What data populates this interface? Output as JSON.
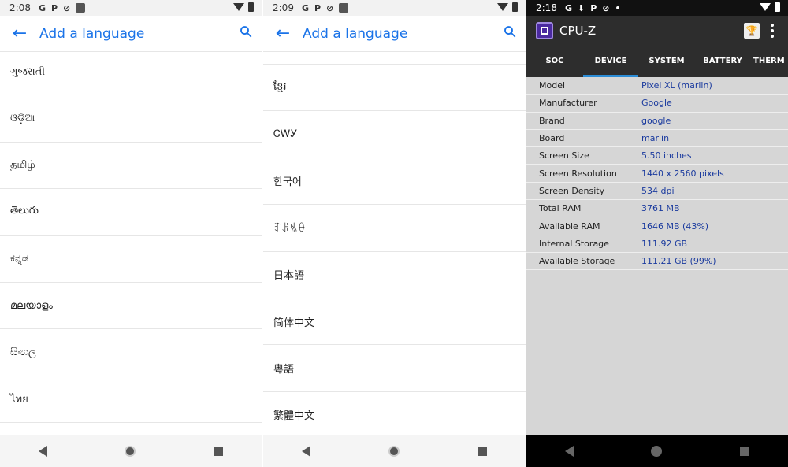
{
  "panel1": {
    "status": {
      "time": "2:08",
      "icons": [
        "G",
        "P",
        "⊘"
      ]
    },
    "appbar": {
      "title": "Add a language"
    },
    "languages": [
      "ગુજરાતી",
      "ଓଡ଼ିଆ",
      "தமிழ்",
      "తెలుగు",
      "ಕನ್ನಡ",
      "മലയാളം",
      "සිංහල",
      "ไทย"
    ]
  },
  "panel2": {
    "status": {
      "time": "2:09",
      "icons": [
        "G",
        "P",
        "⊘"
      ]
    },
    "appbar": {
      "title": "Add a language"
    },
    "languages": [
      "ខ្មែរ",
      "ᏣᎳᎩ",
      "한국어",
      "ꆈꌠꁱꂷ",
      "日本語",
      "简体中文",
      "粵語",
      "繁體中文"
    ]
  },
  "panel3": {
    "status": {
      "time": "2:18",
      "icons": [
        "G",
        "⬇",
        "P",
        "⊘",
        "•"
      ]
    },
    "app_title": "CPU-Z",
    "tabs": [
      "SOC",
      "DEVICE",
      "SYSTEM",
      "BATTERY",
      "THERM"
    ],
    "active_tab": "DEVICE",
    "rows": [
      {
        "key": "Model",
        "value": "Pixel XL (marlin)"
      },
      {
        "key": "Manufacturer",
        "value": "Google"
      },
      {
        "key": "Brand",
        "value": "google"
      },
      {
        "key": "Board",
        "value": "marlin"
      },
      {
        "key": "Screen Size",
        "value": "5.50 inches"
      },
      {
        "key": "Screen Resolution",
        "value": "1440 x 2560 pixels"
      },
      {
        "key": "Screen Density",
        "value": "534 dpi"
      },
      {
        "key": "Total RAM",
        "value": "3761 MB"
      },
      {
        "key": "Available RAM",
        "value": "1646 MB  (43%)"
      },
      {
        "key": "Internal Storage",
        "value": "111.92 GB"
      },
      {
        "key": "Available Storage",
        "value": "111.21 GB (99%)"
      }
    ]
  },
  "colors": {
    "accent": "#1a73e8",
    "tab_indicator": "#2b8cd6",
    "cpuz_value": "#1a3a9e"
  }
}
